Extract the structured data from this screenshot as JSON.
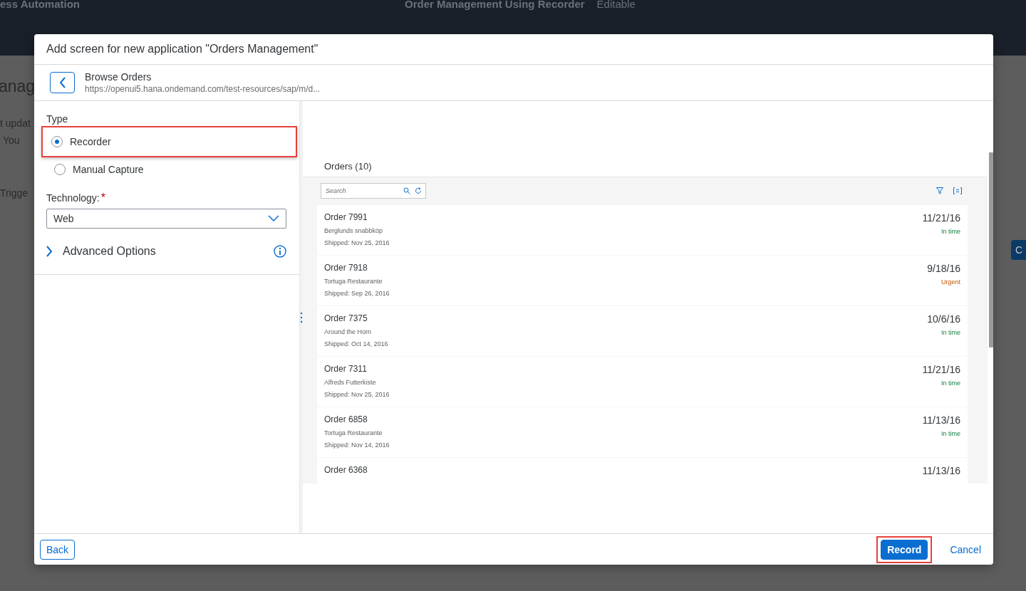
{
  "background": {
    "app_title": "ess Automation",
    "page_title": "Order Management Using Recorder",
    "status": "Editable",
    "heading": "anag",
    "texts": [
      "t updat",
      "You",
      "Trigge"
    ],
    "side_button": "C"
  },
  "dialog": {
    "title": "Add screen for new application \"Orders Management\"",
    "nav": {
      "title": "Browse Orders",
      "url": "https://openui5.hana.ondemand.com/test-resources/sap/m/d..."
    },
    "form": {
      "type_label": "Type",
      "options": [
        {
          "label": "Recorder",
          "selected": true,
          "highlighted": true
        },
        {
          "label": "Manual Capture",
          "selected": false,
          "highlighted": false
        }
      ],
      "technology": {
        "label": "Technology:",
        "required": true,
        "required_mark": "*",
        "value": "Web"
      },
      "advanced": {
        "label": "Advanced Options",
        "expanded": false
      }
    },
    "preview": {
      "list_title": "Orders (10)",
      "search": {
        "placeholder": "Search"
      },
      "orders": [
        {
          "title": "Order 7991",
          "customer": "Berglunds snabbköp",
          "shipped": "Shipped: Nov 25, 2016",
          "date": "11/21/16",
          "status": "In time",
          "kind": "success"
        },
        {
          "title": "Order 7918",
          "customer": "Tortuga Restaurante",
          "shipped": "Shipped: Sep 26, 2016",
          "date": "9/18/16",
          "status": "Urgent",
          "kind": "warning"
        },
        {
          "title": "Order 7375",
          "customer": "Around the Horn",
          "shipped": "Shipped: Oct 14, 2016",
          "date": "10/6/16",
          "status": "In time",
          "kind": "success"
        },
        {
          "title": "Order 7311",
          "customer": "Alfreds Futterkiste",
          "shipped": "Shipped: Nov 25, 2016",
          "date": "11/21/16",
          "status": "In time",
          "kind": "success"
        },
        {
          "title": "Order 6858",
          "customer": "Tortuga Restaurante",
          "shipped": "Shipped: Nov 14, 2016",
          "date": "11/13/16",
          "status": "In time",
          "kind": "success"
        },
        {
          "title": "Order 6368",
          "date": "11/13/16"
        }
      ]
    },
    "footer": {
      "back": "Back",
      "record": {
        "label": "Record",
        "highlighted": true
      },
      "cancel": "Cancel"
    }
  }
}
